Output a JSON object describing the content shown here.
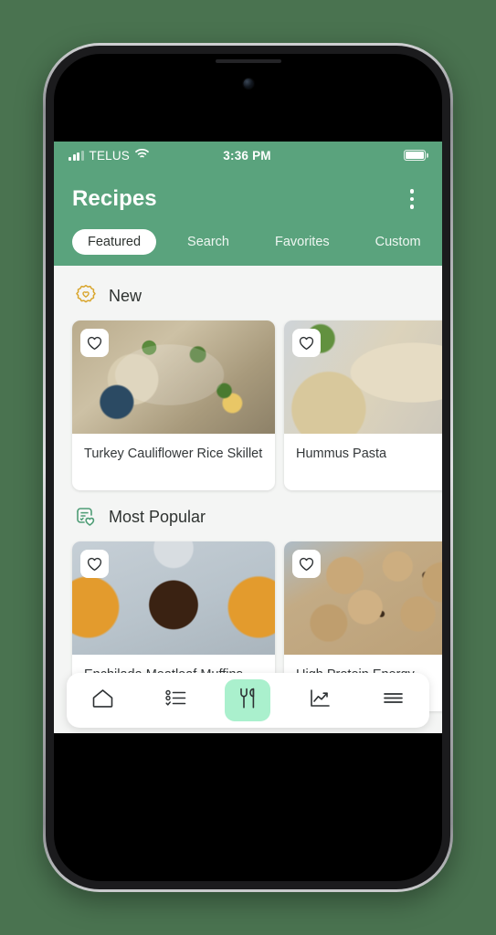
{
  "background_color": "#4a7350",
  "theme": {
    "header_green": "#5aa37d",
    "content_bg": "#f4f5f4",
    "card_bg": "#ffffff",
    "active_nav_mint": "#aaf0cd",
    "new_badge_gold": "#d9a62e",
    "popular_icon_green": "#5aa37d"
  },
  "status_bar": {
    "carrier": "TELUS",
    "time": "3:36 PM",
    "signal_icon": "signal-bars-icon",
    "wifi_icon": "wifi-icon",
    "battery_icon": "battery-full-icon"
  },
  "header": {
    "title": "Recipes",
    "menu_icon": "kebab-menu-icon",
    "tabs": [
      {
        "label": "Featured",
        "active": true
      },
      {
        "label": "Search",
        "active": false
      },
      {
        "label": "Favorites",
        "active": false
      },
      {
        "label": "Custom",
        "active": false
      }
    ]
  },
  "sections": [
    {
      "title": "New",
      "icon": "new-badge-heart-icon",
      "cards": [
        {
          "title": "Turkey Cauliflower Rice Skillet",
          "favorite_icon": "heart-outline-icon",
          "image": "turkey-cauliflower-rice-skillet-photo"
        },
        {
          "title": "Hummus Pasta",
          "favorite_icon": "heart-outline-icon",
          "image": "hummus-pasta-photo"
        }
      ]
    },
    {
      "title": "Most Popular",
      "icon": "popular-list-heart-icon",
      "cards": [
        {
          "title": "Enchilada Meatloaf Muffins",
          "favorite_icon": "heart-outline-icon",
          "image": "enchilada-meatloaf-muffins-photo"
        },
        {
          "title": "High Protein Energy",
          "favorite_icon": "heart-outline-icon",
          "image": "high-protein-energy-balls-photo"
        }
      ]
    }
  ],
  "bottom_nav": [
    {
      "icon": "home-icon",
      "active": false
    },
    {
      "icon": "checklist-icon",
      "active": false
    },
    {
      "icon": "fork-knife-icon",
      "active": true
    },
    {
      "icon": "chart-line-icon",
      "active": false
    },
    {
      "icon": "hamburger-menu-icon",
      "active": false
    }
  ]
}
